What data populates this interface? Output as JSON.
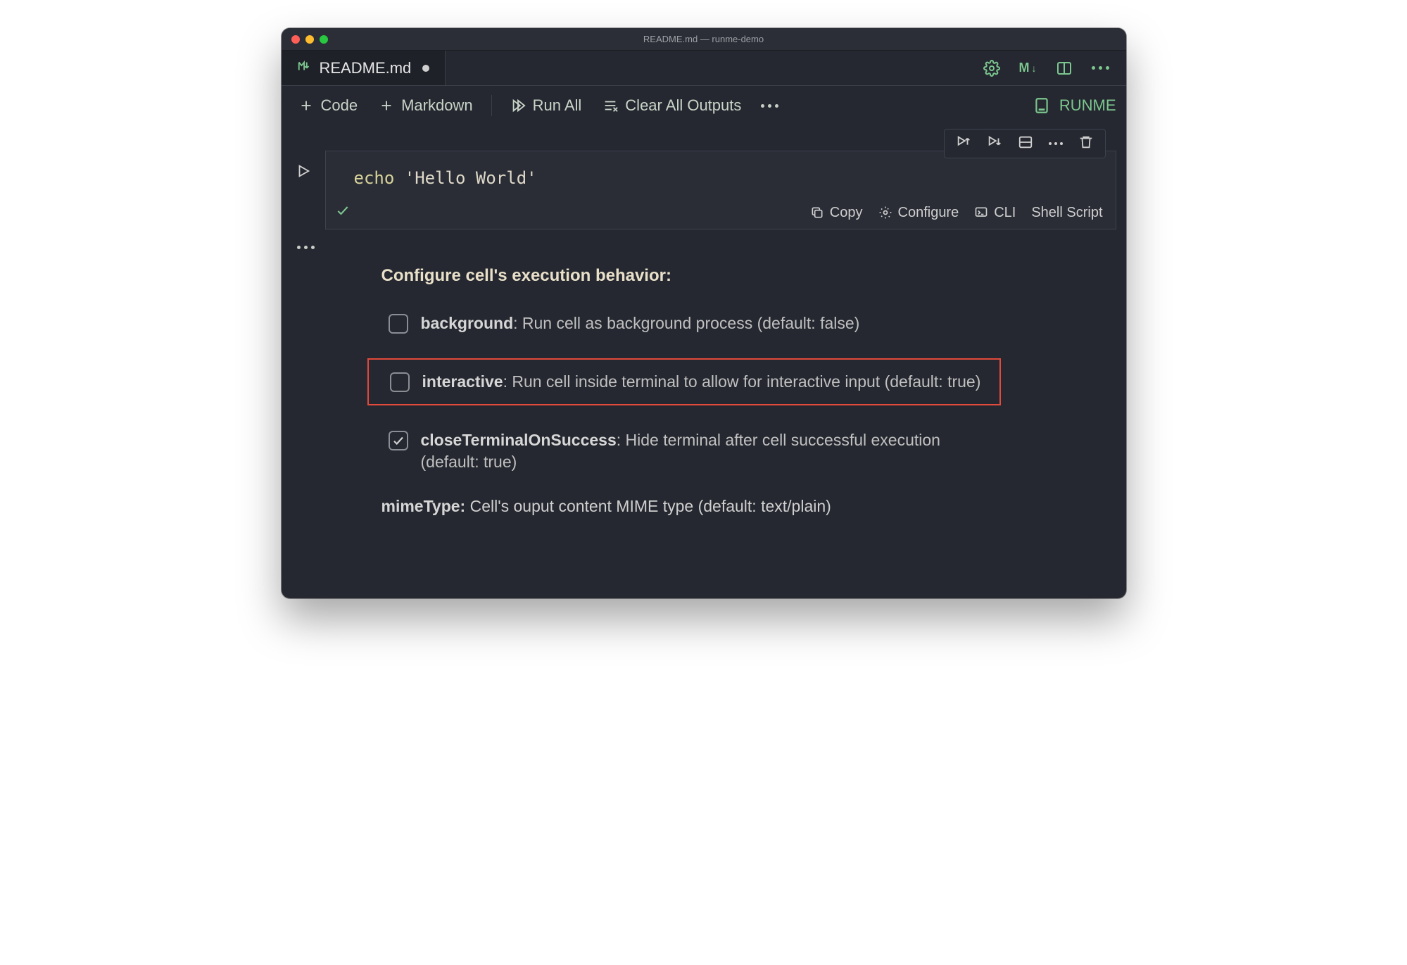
{
  "window": {
    "title": "README.md — runme-demo"
  },
  "tab": {
    "icon": "markdown-icon",
    "filename": "README.md",
    "dirty": true
  },
  "tab_actions": {
    "m_label": "M↓"
  },
  "toolbar": {
    "code": "Code",
    "markdown": "Markdown",
    "run_all": "Run All",
    "clear": "Clear All Outputs",
    "kernel": "RUNME"
  },
  "cell": {
    "code_kw": "echo",
    "code_str": "'Hello World'",
    "actions": {
      "copy": "Copy",
      "configure": "Configure",
      "cli": "CLI",
      "lang": "Shell Script"
    }
  },
  "config": {
    "heading": "Configure cell's execution behavior:",
    "options": [
      {
        "key": "background",
        "label": "background",
        "desc": ": Run cell as background process (default: false)",
        "checked": false,
        "highlight": false
      },
      {
        "key": "interactive",
        "label": "interactive",
        "desc": ": Run cell inside terminal to allow for interactive input (default: true)",
        "checked": false,
        "highlight": true
      },
      {
        "key": "closeTerminalOnSuccess",
        "label": "closeTerminalOnSuccess",
        "desc": ": Hide terminal after cell successful execution (default: true)",
        "checked": true,
        "highlight": false
      }
    ],
    "mime_label": "mimeType:",
    "mime_desc": " Cell's ouput content MIME type (default: text/plain)"
  }
}
